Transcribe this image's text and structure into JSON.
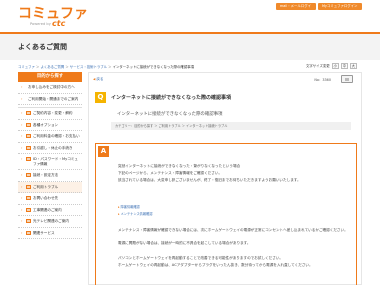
{
  "header": {
    "logo": "コミュファ",
    "logo_sub": "Powered by",
    "logo_ctc": "ctc",
    "btn_mail": "mail・メールログイン",
    "btn_mypage": "Myコミュファログイン"
  },
  "page": {
    "title": "よくあるご質問"
  },
  "breadcrumb": {
    "items": [
      "コミュファ",
      "よくあるご質問",
      "サービス・技術トラブル",
      "インターネットに接続ができなくなった際の確認事項"
    ]
  },
  "font_size": {
    "label": "文字サイズ変更",
    "small": "小",
    "medium": "中",
    "large": "大"
  },
  "sidebar": {
    "header": "目的から探す",
    "items": [
      {
        "label": "お申し込みをご検討中の方へ",
        "icon": false
      },
      {
        "label": "ご利用開始・開通までのご案内",
        "icon": false
      },
      {
        "label": "ご契約内容・変更・解約",
        "icon": true
      },
      {
        "label": "各種オプション",
        "icon": true
      },
      {
        "label": "ご利用料金の確認・お支払い",
        "icon": true
      },
      {
        "label": "お引越し・休止の手続き",
        "icon": true
      },
      {
        "label": "ID・パスワード・Myコミュファ情報",
        "icon": true
      },
      {
        "label": "接続・設定方法",
        "icon": true
      },
      {
        "label": "ご利用トラブル",
        "icon": true,
        "highlight": true
      },
      {
        "label": "お問い合わせ先",
        "icon": true
      },
      {
        "label": "工事関連のご案内",
        "icon": true
      },
      {
        "label": "光テレビ関連のご案内",
        "icon": true
      },
      {
        "label": "関連サービス",
        "icon": true
      }
    ]
  },
  "main": {
    "back": "戻る",
    "qno": "No：3360",
    "q_badge": "Q",
    "q_title": "インターネットに接続ができなくなった際の確認事項",
    "q_text": "インターネットに接続ができなくなった際の確認事項",
    "category": "カテゴリー：目的から探す ＞ ご利用トラブル ＞ インターネット接続トラブル",
    "a_badge": "A",
    "a_lines": [
      "突然インターネットに接続ができなくなった・繋がりなくなったという場合",
      "下記のページから、メンテナンス・障害情報をご確認ください。",
      "該当されている場合は、大変申し訳ございませんが、終了・復旧までお待ちいただきますようお願いいたします。"
    ],
    "links": [
      "障害情報確認",
      "メンテナンス情報確認"
    ],
    "a_lines2": [
      "メンテナンス・障害情報が確認できない場合には、次にホームゲートウェイの電源が正常にコンセントへ差し込まれているかご確認ください。",
      "電源に問題がない場合は、接続が一時的に不具合を起こしている場合があります。"
    ],
    "a_lines3": [
      "パソコンとホームゲートウェイを再起動することで改善できる可能性がありますのでお試しください。",
      "ホームゲートウェイの再起動は、ACアダプターからプラグをいったん抜き、数分待ってから電源を入れ直してください。"
    ]
  }
}
